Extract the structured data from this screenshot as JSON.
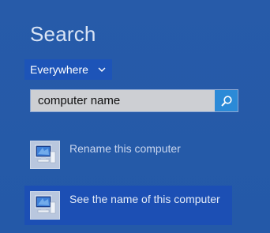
{
  "search_pane": {
    "title": "Search",
    "scope": {
      "label": "Everywhere",
      "icon": "chevron-down-icon"
    },
    "query": {
      "value": "computer name",
      "placeholder": ""
    },
    "search_button": {
      "icon": "magnifier-icon"
    },
    "results": [
      {
        "label": "Rename this computer",
        "icon": "computer-icon",
        "selected": false
      },
      {
        "label": "See the name of this computer",
        "icon": "computer-icon",
        "selected": true
      }
    ]
  },
  "colors": {
    "background": "#2459a8",
    "selection": "#1c4fb4",
    "search_button": "#2b8ad7",
    "search_box": "#cdcfd3"
  }
}
